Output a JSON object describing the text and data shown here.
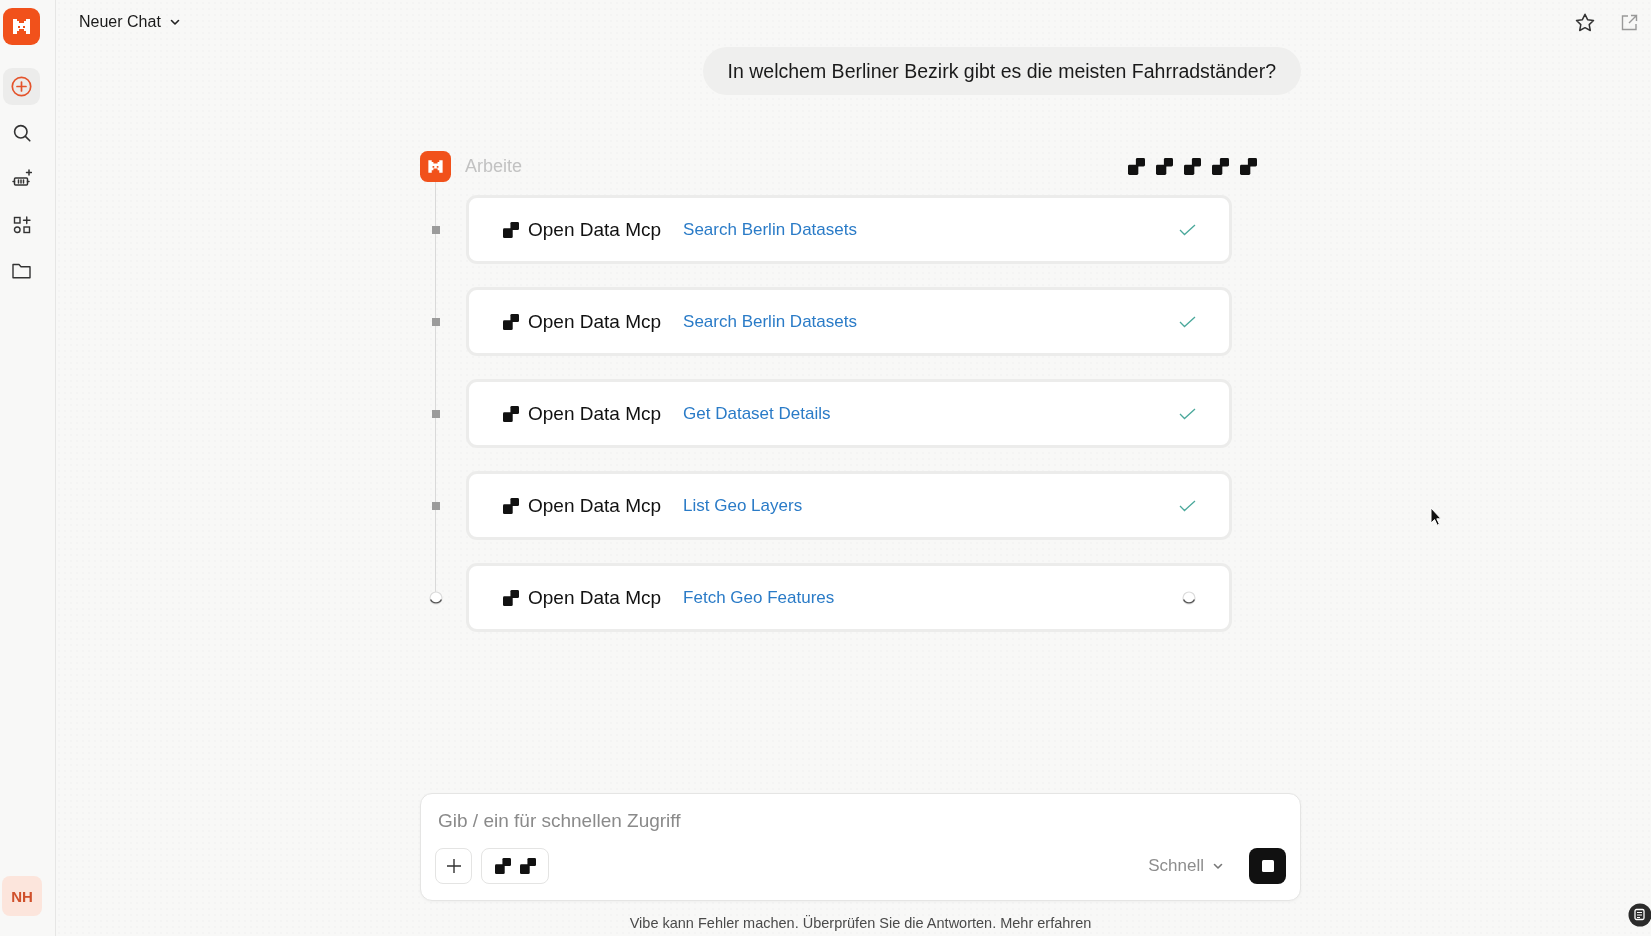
{
  "sidebar": {
    "items": [
      {
        "kind": "new",
        "selected": true
      },
      {
        "kind": "search",
        "selected": false
      },
      {
        "kind": "agents",
        "selected": false
      },
      {
        "kind": "apps",
        "selected": false
      },
      {
        "kind": "folder",
        "selected": false
      }
    ],
    "user": {
      "initials": "NH"
    }
  },
  "header": {
    "title": "Neuer Chat"
  },
  "conversation": {
    "user_message": "In welchem Berliner Bezirk gibt es die meisten Fahrradständer?",
    "assistant": {
      "status": "Arbeite",
      "tool_calls": [
        {
          "server": "Open Data Mcp",
          "tool": "Search Berlin Datasets",
          "done": true
        },
        {
          "server": "Open Data Mcp",
          "tool": "Search Berlin Datasets",
          "done": true
        },
        {
          "server": "Open Data Mcp",
          "tool": "Get Dataset Details",
          "done": true
        },
        {
          "server": "Open Data Mcp",
          "tool": "List Geo Layers",
          "done": true
        },
        {
          "server": "Open Data Mcp",
          "tool": "Fetch Geo Features",
          "done": false
        }
      ]
    }
  },
  "composer": {
    "placeholder": "Gib / ein für schnellen Zugriff",
    "mode": "Schnell",
    "generating": true
  },
  "footer": {
    "text": "Vibe kann Fehler machen. Überprüfen Sie die Antworten.",
    "link": "Mehr erfahren"
  }
}
